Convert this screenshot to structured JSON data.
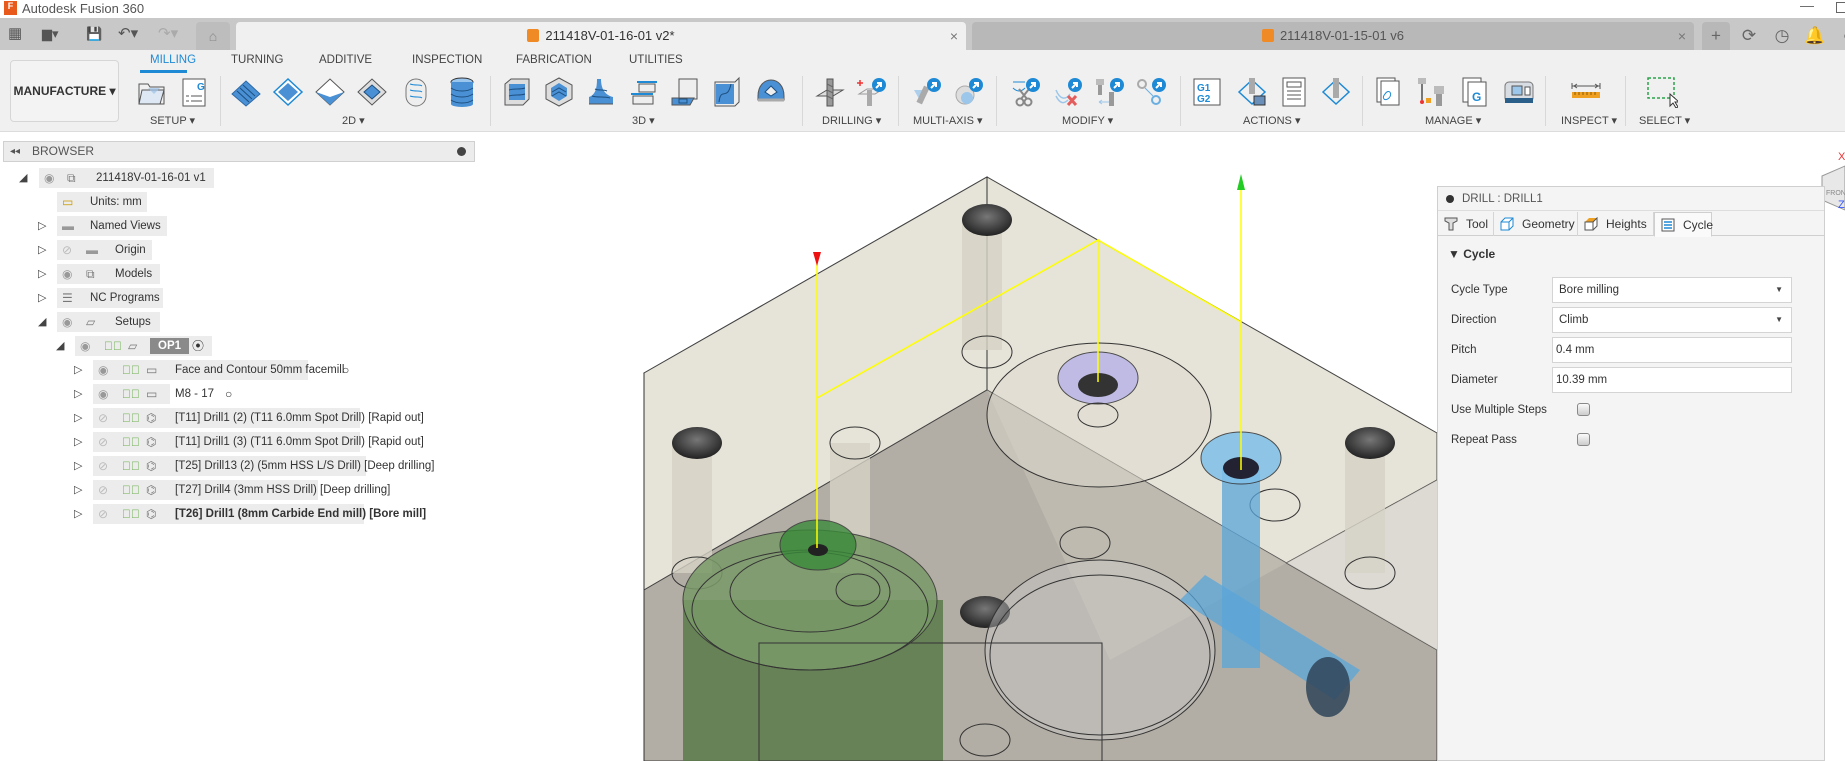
{
  "app": {
    "title": "Autodesk Fusion 360",
    "logo_letter": "F"
  },
  "tabs": {
    "active": {
      "label": "211418V-01-16-01 v2*",
      "close": "×"
    },
    "inactive": {
      "label": "211418V-01-15-01 v6",
      "close": "×"
    },
    "new_tab": "+"
  },
  "quick_access": {
    "grid": "▦",
    "file": "▆▾",
    "save": "💾",
    "undo": "↶▾",
    "redo": "↷▾",
    "home": "⌂"
  },
  "top_right_icons": [
    "⟳",
    "◷",
    "🔔",
    "◐"
  ],
  "ribbon": {
    "workspace": "MANUFACTURE ▾",
    "tabs": [
      "MILLING",
      "TURNING",
      "ADDITIVE",
      "INSPECTION",
      "FABRICATION",
      "UTILITIES"
    ],
    "active_tab": "MILLING",
    "groups": {
      "setup": "SETUP ▾",
      "2d": "2D ▾",
      "3d": "3D ▾",
      "drilling": "DRILLING ▾",
      "multiaxis": "MULTI-AXIS ▾",
      "modify": "MODIFY ▾",
      "actions": "ACTIONS ▾",
      "manage": "MANAGE ▾",
      "inspect": "INSPECT ▾",
      "select": "SELECT ▾"
    }
  },
  "browser": {
    "title": "BROWSER",
    "collapse": "◂◂",
    "root": "211418V-01-16-01 v1",
    "units": "Units: mm",
    "named_views": "Named Views",
    "origin": "Origin",
    "models": "Models",
    "nc_programs": "NC Programs",
    "setups": "Setups",
    "op1": "OP1",
    "operations": [
      {
        "label": "Face and Contour 50mm facemill",
        "visible": true,
        "folder": true,
        "radio": true,
        "bold": false
      },
      {
        "label": "M8 - 17",
        "visible": true,
        "folder": true,
        "radio": true,
        "bold": false
      },
      {
        "label": "[T11] Drill1 (2) (T11 6.0mm Spot Drill) [Rapid out]",
        "visible": false,
        "folder": false,
        "radio": false,
        "bold": false
      },
      {
        "label": "[T11] Drill1 (3) (T11 6.0mm Spot Drill) [Rapid out]",
        "visible": false,
        "folder": false,
        "radio": false,
        "bold": false
      },
      {
        "label": "[T25] Drill13 (2) (5mm HSS L/S Drill) [Deep drilling]",
        "visible": false,
        "folder": false,
        "radio": false,
        "bold": false
      },
      {
        "label": "[T27] Drill4 (3mm HSS Drill) [Deep drilling]",
        "visible": false,
        "folder": false,
        "radio": false,
        "bold": false
      },
      {
        "label": "[T26] Drill1 (8mm Carbide End mill) [Bore mill]",
        "visible": false,
        "folder": false,
        "radio": false,
        "bold": true
      }
    ]
  },
  "panel": {
    "title": "DRILL : DRILL1",
    "tabs": [
      "Tool",
      "Geometry",
      "Heights",
      "Cycle"
    ],
    "active_tab": "Cycle",
    "section": "▼ Cycle",
    "fields": {
      "cycle_type": {
        "label": "Cycle Type",
        "value": "Bore milling"
      },
      "direction": {
        "label": "Direction",
        "value": "Climb"
      },
      "pitch": {
        "label": "Pitch",
        "value": "0.4 mm"
      },
      "diameter": {
        "label": "Diameter",
        "value": "10.39 mm"
      },
      "multiple_steps": {
        "label": "Use Multiple Steps",
        "checked": false
      },
      "repeat_pass": {
        "label": "Repeat Pass",
        "checked": false
      }
    }
  },
  "viewcube": {
    "face": "FRONT",
    "axis_label": "Z",
    "x_axis": "X"
  },
  "colors": {
    "accent": "#1e8ad6",
    "toolpath": "#ffff00",
    "check": "#6ab04c",
    "drilled_blue": "#4a9fd4",
    "green_feature": "#5b7a4a"
  }
}
